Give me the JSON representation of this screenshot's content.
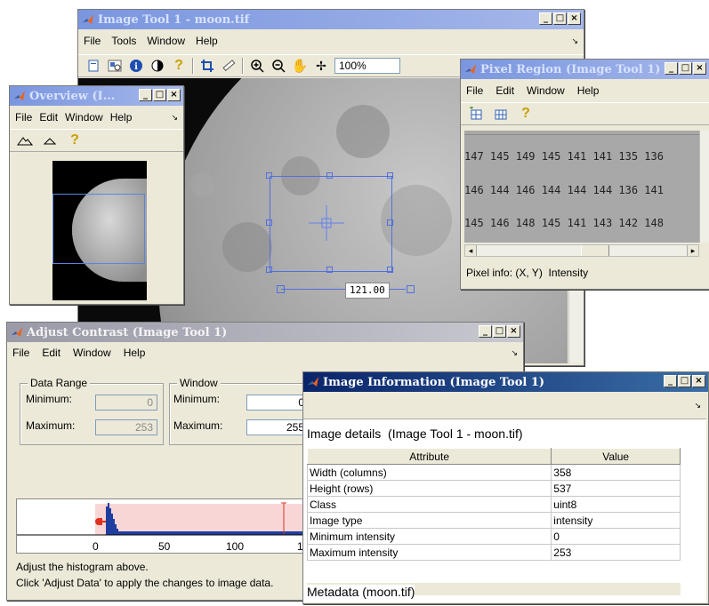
{
  "image_tool": {
    "title": "Image Tool 1 - moon.tif",
    "menu": [
      "File",
      "Tools",
      "Window",
      "Help"
    ],
    "zoom": "100%",
    "roi_label": "121.00"
  },
  "overview": {
    "title": "Overview (I...",
    "menu": [
      "File",
      "Edit",
      "Window",
      "Help"
    ]
  },
  "pixel_region": {
    "title": "Pixel Region (Image Tool 1)",
    "menu": [
      "File",
      "Edit",
      "Window",
      "Help"
    ],
    "rows": [
      "147 145 149 145 141 141 135 136",
      "146 144 146 144 144 144 136 141",
      "145 146 148 145 141 143 142 148"
    ],
    "status": "Pixel info: (X, Y)  Intensity"
  },
  "adjust_contrast": {
    "title": "Adjust Contrast (Image Tool 1)",
    "menu": [
      "File",
      "Edit",
      "Window",
      "Help"
    ],
    "data_range": {
      "legend": "Data Range",
      "min_label": "Minimum:",
      "min_value": "0",
      "max_label": "Maximum:",
      "max_value": "253"
    },
    "window": {
      "legend": "Window",
      "min_label": "Minimum:",
      "min_value": "0",
      "max_label": "Maximum:",
      "max_value": "255"
    },
    "axis_ticks": [
      "0",
      "50",
      "100",
      "1"
    ],
    "help_line1": "Adjust the histogram above.",
    "help_line2": "Click 'Adjust Data' to apply the changes to image data."
  },
  "image_info": {
    "title": "Image Information (Image Tool 1)",
    "details_label": "Image details  (Image Tool 1 - moon.tif)",
    "columns": [
      "Attribute",
      "Value"
    ],
    "rows": [
      {
        "attr": "Width (columns)",
        "value": "358"
      },
      {
        "attr": "Height (rows)",
        "value": "537"
      },
      {
        "attr": "Class",
        "value": "uint8"
      },
      {
        "attr": "Image type",
        "value": "intensity"
      },
      {
        "attr": "Minimum intensity",
        "value": "0"
      },
      {
        "attr": "Maximum intensity",
        "value": "253"
      }
    ],
    "metadata_label": "Metadata (moon.tif)"
  },
  "colors": {
    "title_active": "#0a246a",
    "title_inactive": "#7a96df",
    "window_bg": "#ece9d8",
    "histogram_bg": "#f9d6d6",
    "histogram_bar": "#1f3fa0",
    "marker_red": "#e03020",
    "roi_blue": "#3050c8"
  }
}
